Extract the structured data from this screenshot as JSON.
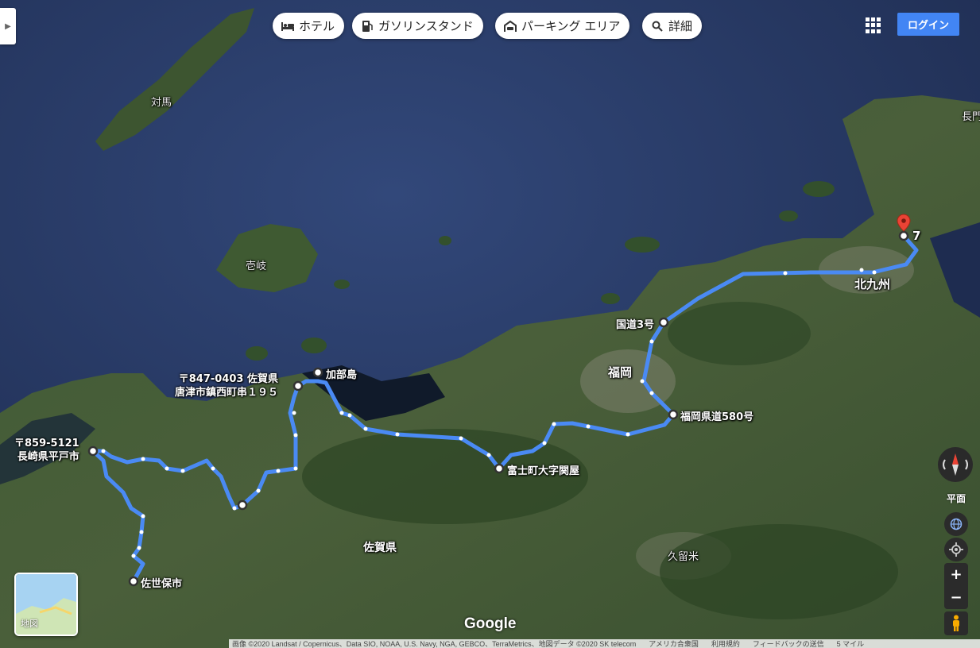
{
  "chips": {
    "hotel": "ホテル",
    "gas": "ガソリンスタンド",
    "parking": "パーキング エリア",
    "more": "詳細"
  },
  "header": {
    "login": "ログイン"
  },
  "places": {
    "tsushima": "対馬",
    "iki": "壱岐",
    "kitakyushu": "北九州",
    "nagato": "長門",
    "fukuoka": "福岡",
    "saga": "佐賀県",
    "kurume": "久留米"
  },
  "waypoints": {
    "wp7": "7",
    "route3": "国道3号",
    "pref580": "福岡県道580号",
    "fujicho": "富士町大字関屋",
    "kabeshima": "加部島",
    "karatsu": "〒847-0403 佐賀県\n唐津市鎮西町串１９５",
    "hirado": "〒859-5121\n長崎県平戸市",
    "sasebo": "佐世保市"
  },
  "controls": {
    "flat": "平面",
    "zoom_in": "+",
    "zoom_out": "−"
  },
  "minimap": {
    "label": "地図"
  },
  "branding": {
    "google": "Google"
  },
  "footer": {
    "imagery": "画像 ©2020 Landsat / Copernicus、Data SIO, NOAA, U.S. Navy, NGA, GEBCO、TerraMetrics、地図データ ©2020 SK telecom",
    "region": "アメリカ合衆国",
    "terms": "利用規約",
    "feedback": "フィードバックの送信",
    "scale": "5 マイル"
  },
  "colors": {
    "route": "#4a8af4",
    "marker": "#ea4335",
    "login": "#4285f4"
  }
}
